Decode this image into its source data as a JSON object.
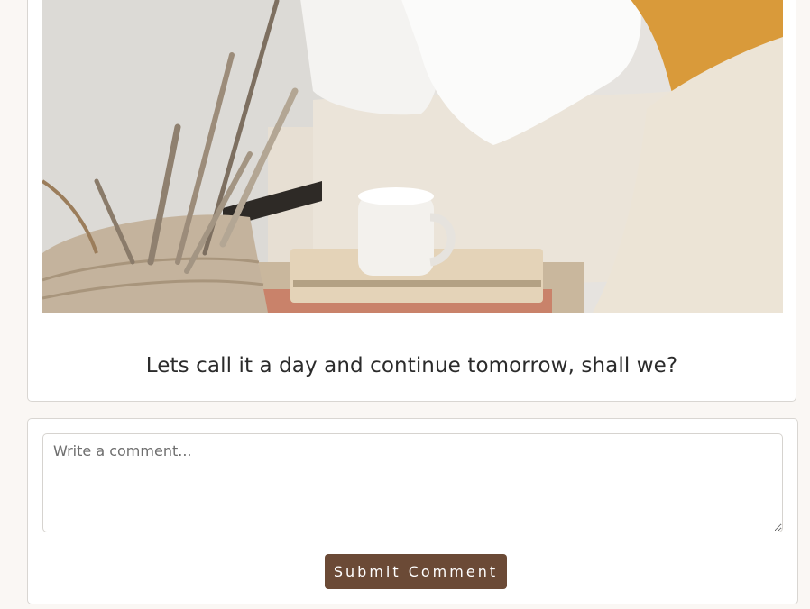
{
  "post": {
    "image_alt": "Bedside scene with a white mug on books, woven basket with driftwood and a bed with pillows",
    "caption": "Lets call it a day and continue tomorrow, shall we?"
  },
  "comment_form": {
    "placeholder": "Write a comment...",
    "value": "",
    "submit_label": "Submit Comment"
  },
  "colors": {
    "page_background": "#faf7f4",
    "button_background": "#6b4a36",
    "button_text": "#ffffff",
    "card_border": "#d9d6d2"
  }
}
